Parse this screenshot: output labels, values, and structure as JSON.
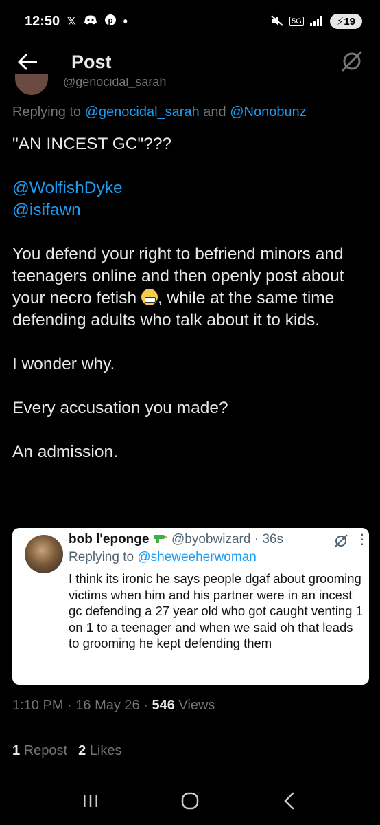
{
  "status_bar": {
    "time": "12:50",
    "network": "5G",
    "battery": "19",
    "icons": [
      "x-icon",
      "discord-icon",
      "pinterest-icon",
      "dot-icon",
      "mute-icon",
      "signal-icon",
      "battery-icon"
    ]
  },
  "header": {
    "title": "Post",
    "icons": [
      "back-arrow-icon",
      "grok-icon"
    ]
  },
  "post": {
    "clipped_handle": "@genocidal_sarah",
    "replying_prefix": "Replying to",
    "replying_user1": "@genocidal_sarah",
    "replying_and": "and",
    "replying_user2": "@Nonobunz",
    "line1": "\"AN INCEST GC\"???",
    "mention1": "@WolfishDyke",
    "mention2": "@isifawn",
    "para1a": "You defend your right to befriend minors and teenagers online and then openly post about your necro fetish ",
    "para1b": ", while at the same time defending adults who talk about it to kids.",
    "para2": "I wonder why.",
    "para3": "Every accusation you made?",
    "para4": "An admission."
  },
  "quoted_screenshot": {
    "name": "bob l'eponge",
    "handle": "@byobwizard",
    "separator": "·",
    "time": "36s",
    "replying_prefix": "Replying to",
    "replying_user": "@sheweeherwoman",
    "text": "I think its ironic he says people dgaf about grooming victims when him and his partner were in an incest gc defending a 27 year old who got caught venting 1 on 1 to a teenager and when we said oh that leads to grooming he kept defending them",
    "more": "⋮"
  },
  "meta": {
    "time": "1:10 PM",
    "sep1": "·",
    "date": "16 May 26",
    "sep2": "·",
    "views_count": "546",
    "views_label": "Views"
  },
  "engagement": {
    "reposts_count": "1",
    "reposts_label": "Repost",
    "likes_count": "2",
    "likes_label": "Likes"
  },
  "colors": {
    "background": "#000000",
    "text": "#e7e9ea",
    "secondary": "#71767b",
    "link": "#1d9bf0"
  }
}
